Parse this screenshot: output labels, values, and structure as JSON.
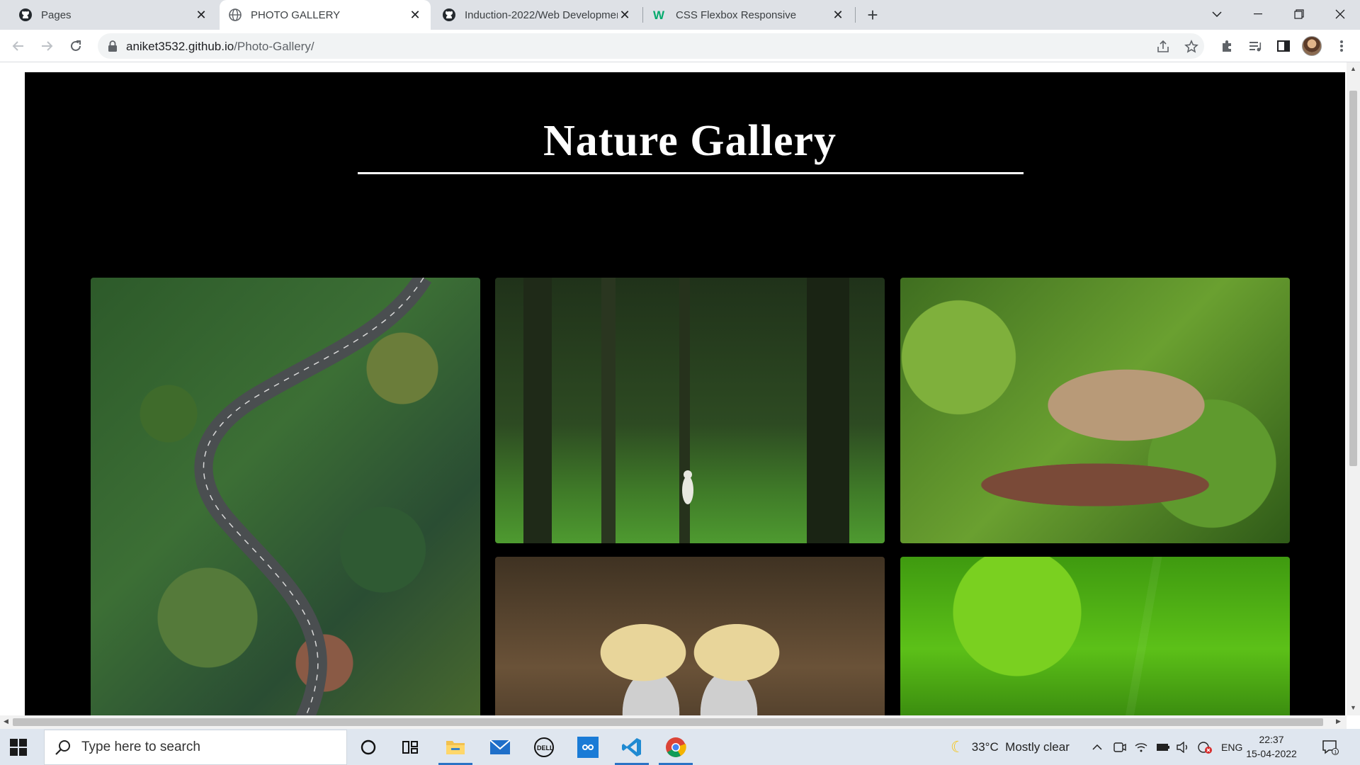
{
  "browser": {
    "tabs": [
      {
        "title": "Pages",
        "icon": "github-icon"
      },
      {
        "title": "PHOTO GALLERY",
        "icon": "globe-icon",
        "active": true
      },
      {
        "title": "Induction-2022/Web Development",
        "icon": "github-icon"
      },
      {
        "title": "CSS Flexbox Responsive",
        "icon": "w3schools-icon"
      }
    ],
    "url_host": "aniket3532.github.io",
    "url_path": "/Photo-Gallery/"
  },
  "page": {
    "title_word1": "Nature",
    "title_word2": "Gallery",
    "photos": [
      {
        "subject": "aerial winding forest road"
      },
      {
        "subject": "person in green forest"
      },
      {
        "subject": "chipmunk on branch"
      },
      {
        "subject": "crowned cranes"
      },
      {
        "subject": "dewy green grass"
      }
    ]
  },
  "taskbar": {
    "search_placeholder": "Type here to search",
    "weather": "33°C  Mostly clear",
    "language": "ENG",
    "time": "22:37",
    "date": "15-04-2022",
    "notification_count": "1"
  },
  "colors": {
    "page_bg": "#000000",
    "title": "#ffffff",
    "tabstrip": "#dee1e6",
    "taskbar": "#dfe6ef",
    "accent": "#2b73c5"
  }
}
